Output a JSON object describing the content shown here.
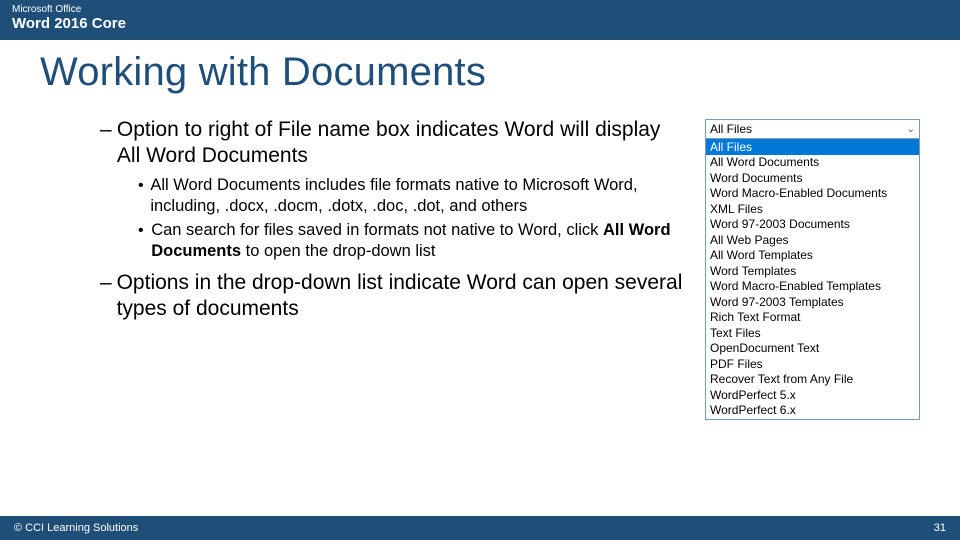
{
  "header": {
    "top": "Microsoft Office",
    "main": "Word 2016 Core"
  },
  "title": "Working with Documents",
  "bullets": {
    "item1": {
      "dash": "–",
      "text": "Option to right of File name box indicates Word will display All Word Documents",
      "sub1_dot": "•",
      "sub1": "All Word Documents includes file formats native to Microsoft Word, including, .docx, .docm, .dotx, .doc, .dot, and others",
      "sub2_dot": "•",
      "sub2a": "Can search for files saved in formats not native to Word, click ",
      "sub2b": "All Word Documents",
      "sub2c": " to open the drop-down list"
    },
    "item2": {
      "dash": "–",
      "text": "Options in the drop-down list indicate Word can open several types of documents"
    }
  },
  "dropdown": {
    "selected": "All Files",
    "highlighted": "All Files",
    "options": [
      "All Word Documents",
      "Word Documents",
      "Word Macro-Enabled Documents",
      "XML Files",
      "Word 97-2003 Documents",
      "All Web Pages",
      "All Word Templates",
      "Word Templates",
      "Word Macro-Enabled Templates",
      "Word 97-2003 Templates",
      "Rich Text Format",
      "Text Files",
      "OpenDocument Text",
      "PDF Files",
      "Recover Text from Any File",
      "WordPerfect 5.x",
      "WordPerfect 6.x"
    ]
  },
  "footer": {
    "copyright": "© CCI Learning Solutions",
    "page": "31"
  }
}
